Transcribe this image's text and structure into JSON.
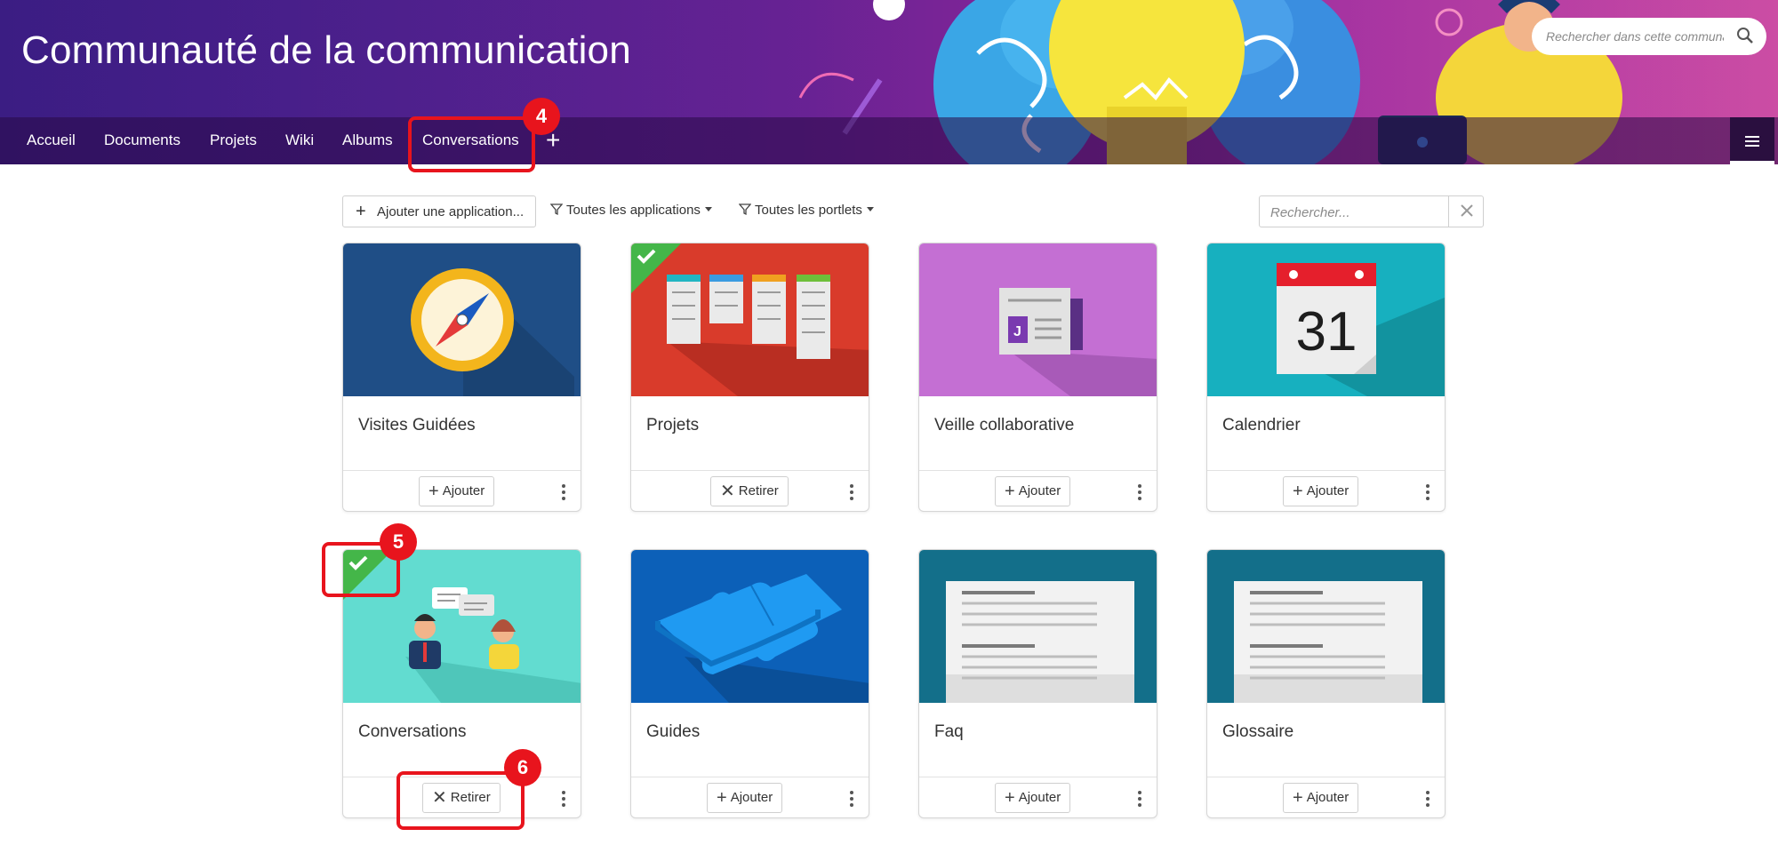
{
  "header": {
    "site_title": "Communauté de la communication",
    "search_placeholder": "Rechercher dans cette communauté",
    "nav": [
      {
        "label": "Accueil"
      },
      {
        "label": "Documents"
      },
      {
        "label": "Projets"
      },
      {
        "label": "Wiki"
      },
      {
        "label": "Albums"
      },
      {
        "label": "Conversations"
      }
    ],
    "add_page_icon": "plus-icon",
    "menu_icon": "hamburger-icon"
  },
  "annotations": {
    "badge_4": "4",
    "badge_5": "5",
    "badge_6": "6",
    "color": "#e8141d"
  },
  "toolbar": {
    "add_app_label": "Ajouter une application...",
    "filter_apps_label": "Toutes les applications",
    "filter_portlets_label": "Toutes les portlets",
    "search_placeholder": "Rechercher..."
  },
  "cards": [
    {
      "title": "Visites Guidées",
      "action": "Ajouter",
      "action_icon": "plus",
      "installed": false,
      "image": "compass"
    },
    {
      "title": "Projets",
      "action": "Retirer",
      "action_icon": "close",
      "installed": true,
      "image": "kanban-board"
    },
    {
      "title": "Veille collaborative",
      "action": "Ajouter",
      "action_icon": "plus",
      "installed": false,
      "image": "newsletter"
    },
    {
      "title": "Calendrier",
      "action": "Ajouter",
      "action_icon": "plus",
      "installed": false,
      "image": "calendar",
      "calendar_day": "31"
    },
    {
      "title": "Conversations",
      "action": "Retirer",
      "action_icon": "close",
      "installed": true,
      "image": "conversation"
    },
    {
      "title": "Guides",
      "action": "Ajouter",
      "action_icon": "plus",
      "installed": false,
      "image": "puzzle"
    },
    {
      "title": "Faq",
      "action": "Ajouter",
      "action_icon": "plus",
      "installed": false,
      "image": "document"
    },
    {
      "title": "Glossaire",
      "action": "Ajouter",
      "action_icon": "plus",
      "installed": false,
      "image": "document"
    }
  ],
  "colors": {
    "installed_badge": "#44b649",
    "card_visites": "#1f4e86",
    "card_projets": "#d93b2b",
    "card_veille": "#c46fd3",
    "card_calendrier": "#17b0bf",
    "card_conversations": "#62dcd0",
    "card_guides": "#0c60b8",
    "card_doc": "#136f8a"
  }
}
